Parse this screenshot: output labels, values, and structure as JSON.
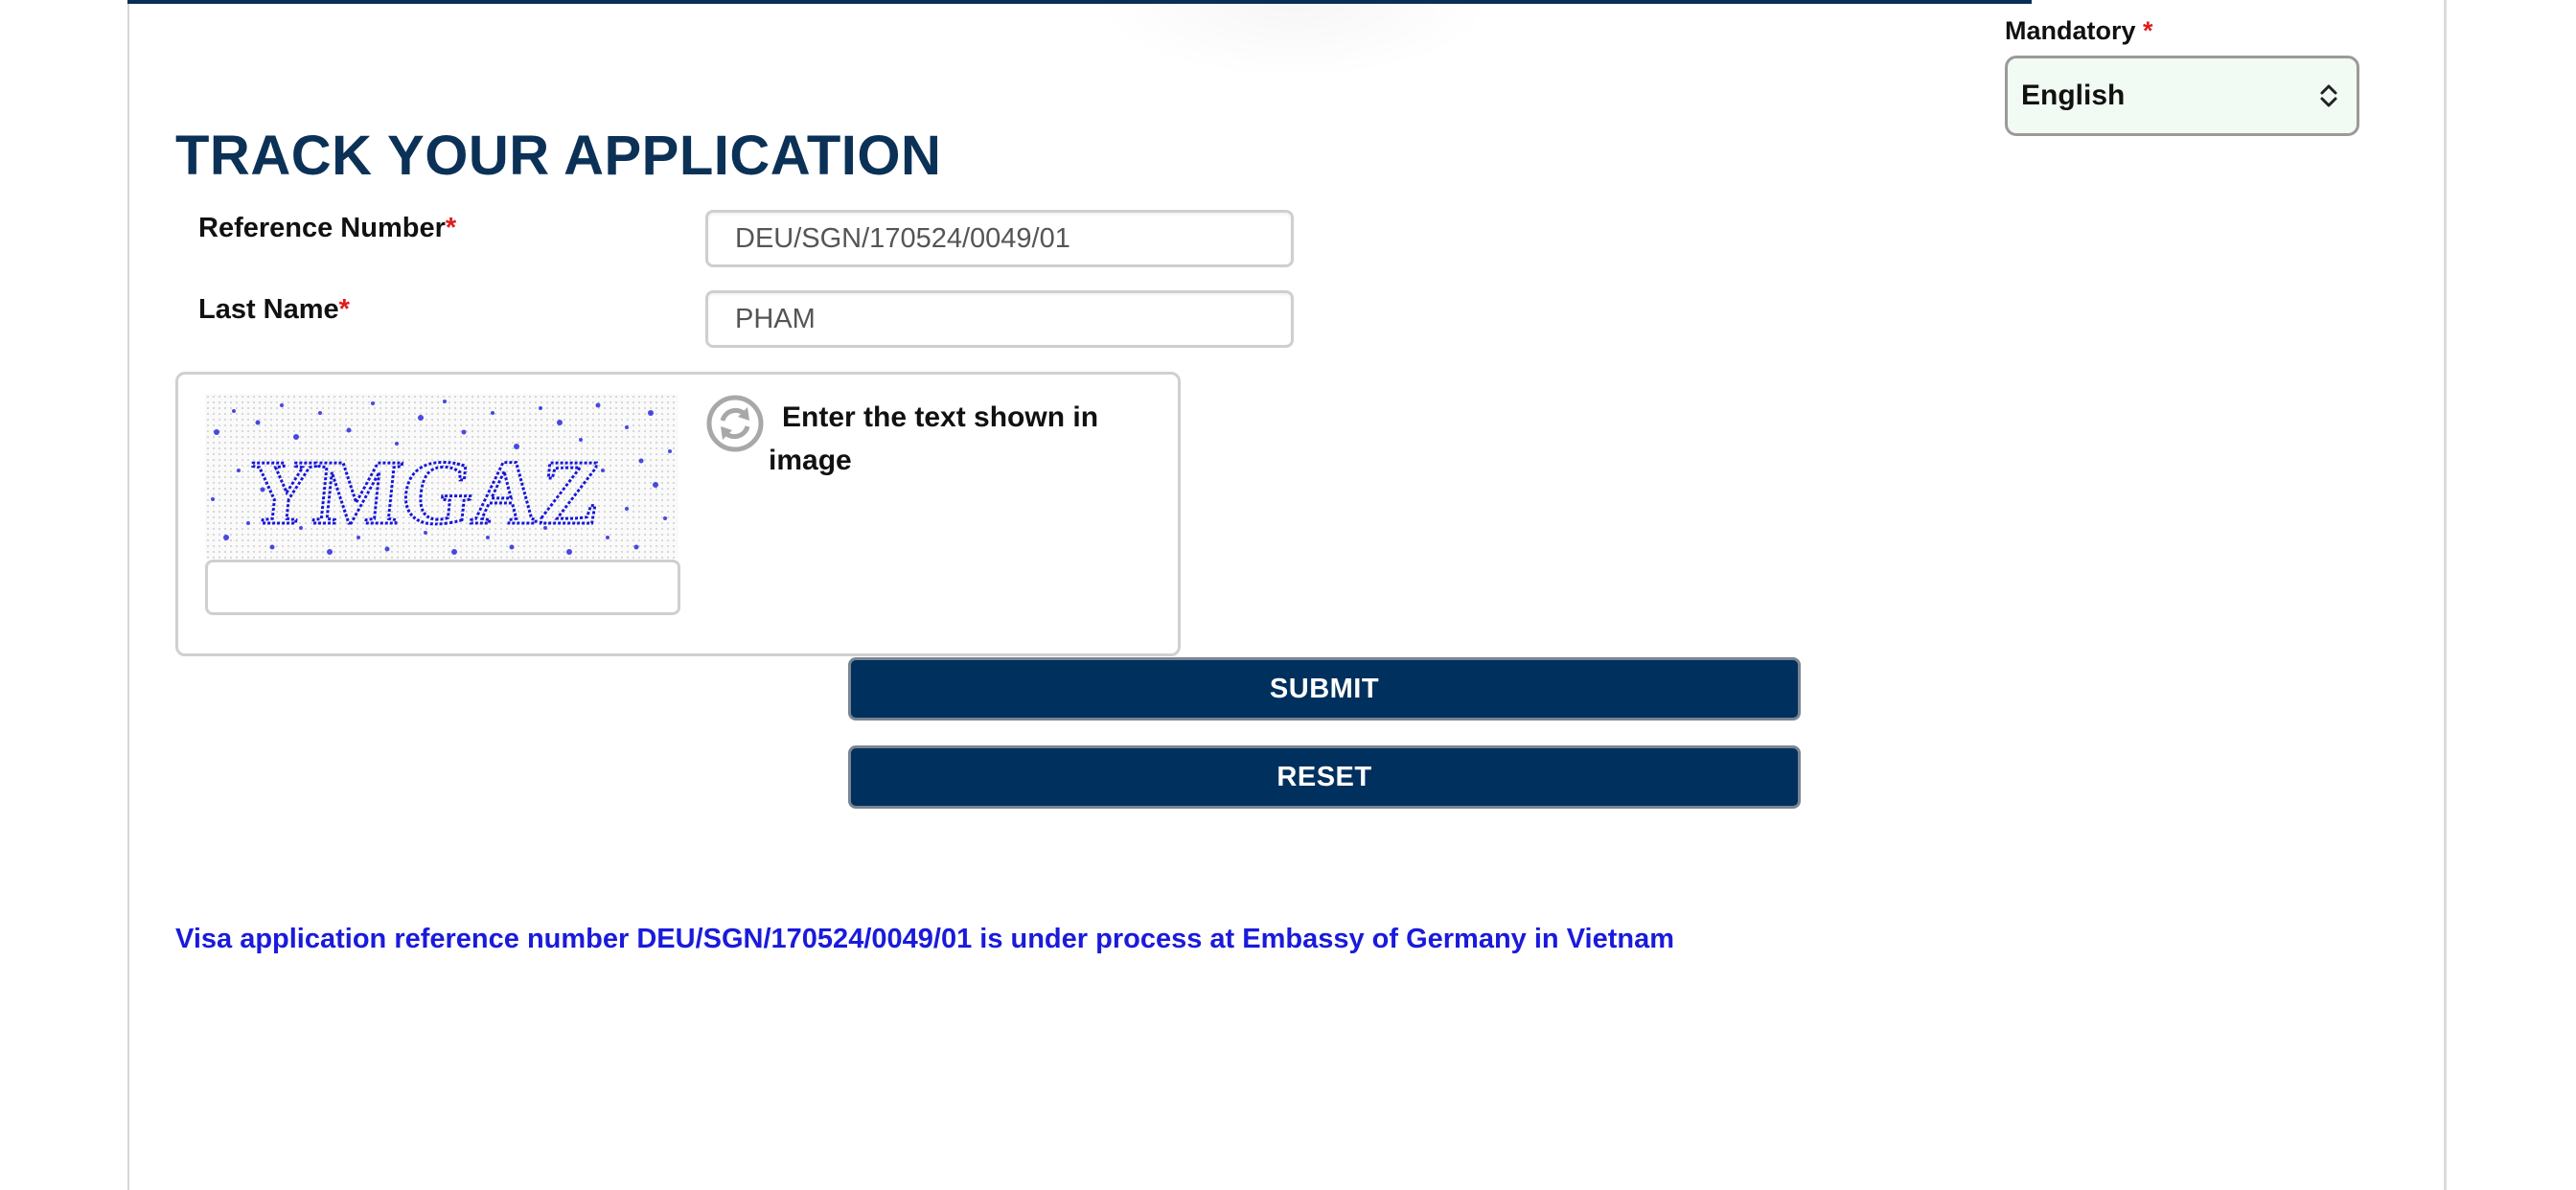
{
  "language": {
    "label": "Mandatory",
    "required_mark": "*",
    "selected": "English"
  },
  "page": {
    "title": "TRACK YOUR APPLICATION"
  },
  "form": {
    "reference_number": {
      "label": "Reference Number",
      "required_mark": "*",
      "value": "DEU/SGN/170524/0049/01"
    },
    "last_name": {
      "label": "Last Name",
      "required_mark": "*",
      "value": "PHAM"
    },
    "captcha": {
      "image_text": "YMGAZ",
      "hint": "Enter the text shown in image",
      "value": "",
      "refresh_icon": "refresh-icon"
    },
    "submit_label": "SUBMIT",
    "reset_label": "RESET"
  },
  "status": {
    "message": "Visa application reference number DEU/SGN/170524/0049/01 is under process at Embassy of Germany in Vietnam",
    "color": "#1a1adc"
  },
  "colors": {
    "brand_navy": "#00305d",
    "title_navy": "#0b3157",
    "required_red": "#e01b1b",
    "select_bg": "#f1faf3"
  }
}
